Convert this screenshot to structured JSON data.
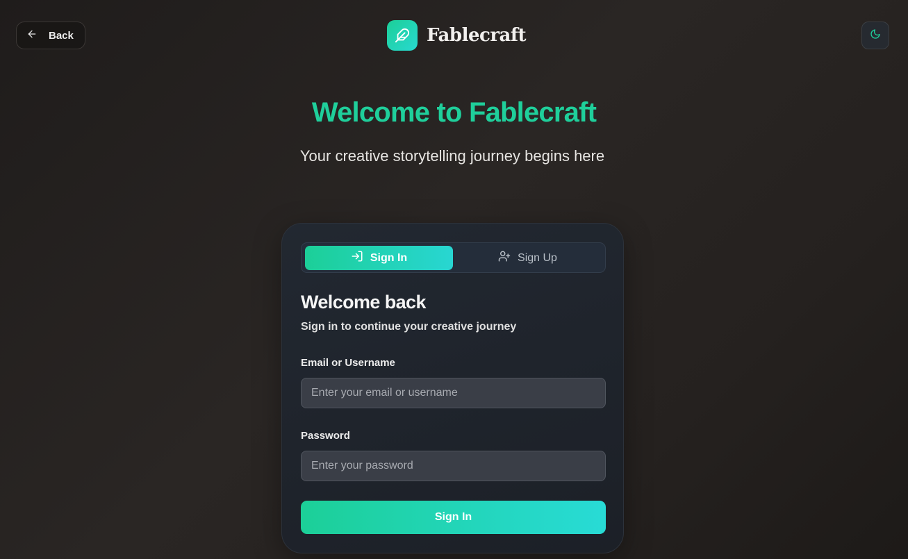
{
  "header": {
    "back_label": "Back",
    "brand_name": "Fablecraft"
  },
  "hero": {
    "title": "Welcome to Fablecraft",
    "subtitle": "Your creative storytelling journey begins here"
  },
  "auth": {
    "tabs": [
      {
        "label": "Sign In",
        "active": true
      },
      {
        "label": "Sign Up",
        "active": false
      }
    ],
    "title": "Welcome back",
    "subtitle": "Sign in to continue your creative journey",
    "fields": [
      {
        "label": "Email or Username",
        "placeholder": "Enter your email or username",
        "value": ""
      },
      {
        "label": "Password",
        "placeholder": "Enter your password",
        "value": ""
      }
    ],
    "submit_label": "Sign In"
  },
  "colors": {
    "accent": "#1fcf9b",
    "accent_alt": "#28d9d0",
    "background": "#25211f",
    "card": "#1f242c"
  },
  "icons": [
    "arrow-left-icon",
    "feather-icon",
    "moon-icon",
    "sign-in-icon",
    "user-plus-icon"
  ]
}
